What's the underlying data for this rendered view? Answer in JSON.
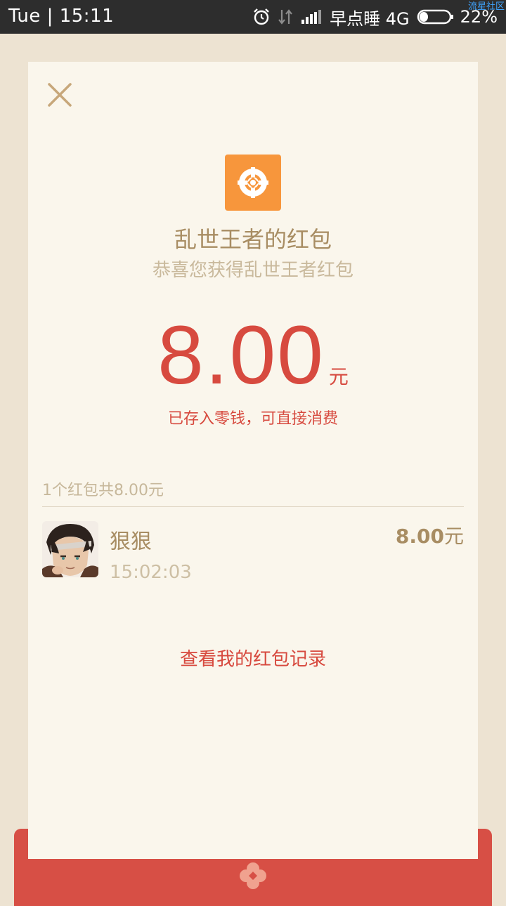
{
  "status_bar": {
    "day_time": "Tue | 15:11",
    "carrier": "早点睡 4G",
    "battery": "22%",
    "watermark": "流星社区",
    "battery_level": 0.22
  },
  "card": {
    "title": "乱世王者的红包",
    "subtitle": "恭喜您获得乱世王者红包",
    "amount": "8.00",
    "amount_unit": "元",
    "stored_note": "已存入零钱，可直接消费",
    "summary": "1个红包共8.00元",
    "entries": [
      {
        "name": "狠狠",
        "time": "15:02:03",
        "amount": "8.00",
        "unit": "元"
      }
    ],
    "records_link": "查看我的红包记录"
  },
  "colors": {
    "accent_red": "#d74a3f",
    "gold": "#a88d63",
    "logo_orange": "#f7963c",
    "card_bg": "#faf6ec",
    "page_bg": "#ede3d2"
  },
  "icons": {
    "close": "close-icon",
    "logo": "game-logo-icon",
    "alarm": "alarm-icon",
    "data": "data-arrows-icon",
    "signal": "signal-icon",
    "battery": "battery-icon",
    "flower": "flower-icon"
  }
}
